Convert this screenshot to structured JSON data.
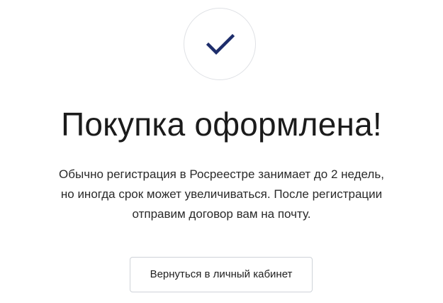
{
  "success_icon": {
    "icon": "checkmark-icon",
    "color": "#1d2d6b",
    "border_color": "#dfe1e5"
  },
  "title": "Покупка оформлена!",
  "description": {
    "lines": [
      "Обычно регистрация в Росреестре занимает до 2 недель,",
      "но иногда срок может увеличиваться. После регистрации",
      "отправим договор вам на почту."
    ]
  },
  "actions": {
    "back_label": "Вернуться в личный кабинет"
  }
}
